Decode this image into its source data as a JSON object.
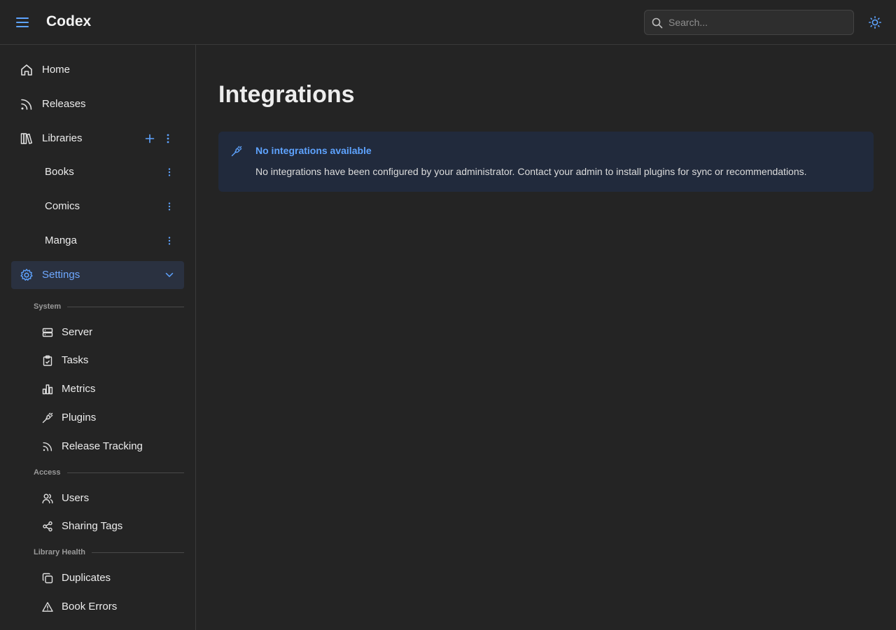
{
  "header": {
    "app_title": "Codex",
    "search_placeholder": "Search...",
    "icons": {
      "menu": "hamburger-menu-icon",
      "search": "search-icon",
      "theme": "sun-icon"
    }
  },
  "colors": {
    "accent": "#5ea3ff",
    "background": "#242424",
    "alert_bg": "#212a3c"
  },
  "sidebar": {
    "nav": [
      {
        "label": "Home",
        "icon": "home-icon"
      },
      {
        "label": "Releases",
        "icon": "rss-icon"
      },
      {
        "label": "Libraries",
        "icon": "library-icon"
      }
    ],
    "libraries": [
      {
        "label": "Books"
      },
      {
        "label": "Comics"
      },
      {
        "label": "Manga"
      }
    ],
    "settings": {
      "label": "Settings",
      "icon": "gear-icon",
      "expanded": true
    },
    "sections": {
      "system": {
        "title": "System",
        "items": [
          {
            "label": "Server",
            "icon": "server-icon"
          },
          {
            "label": "Tasks",
            "icon": "clipboard-icon"
          },
          {
            "label": "Metrics",
            "icon": "bar-chart-icon"
          },
          {
            "label": "Plugins",
            "icon": "plug-icon"
          },
          {
            "label": "Release Tracking",
            "icon": "rss-icon"
          }
        ]
      },
      "access": {
        "title": "Access",
        "items": [
          {
            "label": "Users",
            "icon": "users-icon"
          },
          {
            "label": "Sharing Tags",
            "icon": "share-icon"
          }
        ]
      },
      "health": {
        "title": "Library Health",
        "items": [
          {
            "label": "Duplicates",
            "icon": "copy-icon"
          },
          {
            "label": "Book Errors",
            "icon": "warning-icon"
          }
        ]
      }
    }
  },
  "main": {
    "title": "Integrations",
    "alert": {
      "title": "No integrations available",
      "message": "No integrations have been configured by your administrator. Contact your admin to install plugins for sync or recommendations.",
      "icon": "plug-icon"
    }
  }
}
